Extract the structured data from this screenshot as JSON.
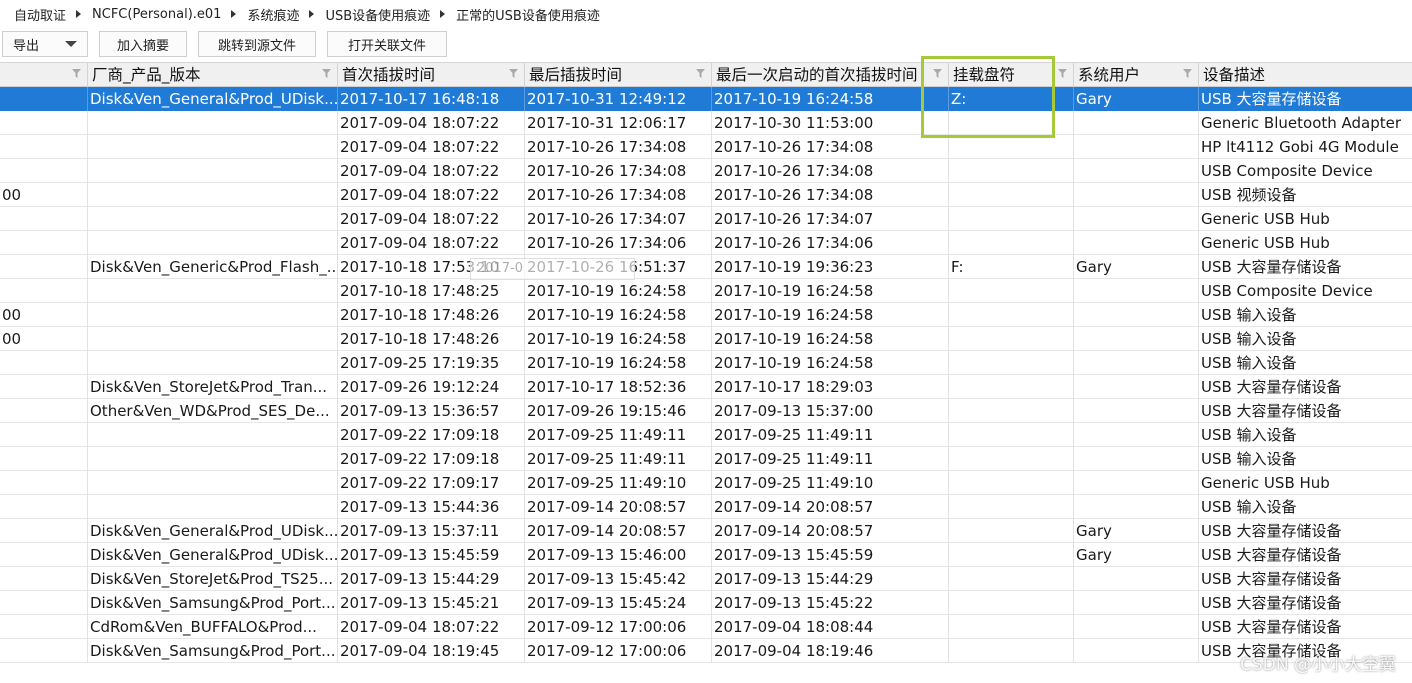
{
  "breadcrumb": [
    "自动取证",
    "NCFC(Personal).e01",
    "系统痕迹",
    "USB设备使用痕迹",
    "正常的USB设备使用痕迹"
  ],
  "toolbar": {
    "export_label": "导出",
    "add_summary_label": "加入摘要",
    "goto_source_label": "跳转到源文件",
    "open_related_label": "打开关联文件"
  },
  "columns": [
    "",
    "厂商_产品_版本",
    "首次插拔时间",
    "最后插拔时间",
    "最后一次启动的首次插拔时间",
    "挂载盘符",
    "系统用户",
    "设备描述"
  ],
  "rows": [
    [
      "",
      "Disk&Ven_General&Prod_UDisk...",
      "2017-10-17 16:48:18",
      "2017-10-31 12:49:12",
      "2017-10-19 16:24:58",
      "Z:",
      "Gary",
      "USB 大容量存储设备"
    ],
    [
      "",
      "",
      "2017-09-04 18:07:22",
      "2017-10-31 12:06:17",
      "2017-10-30 11:53:00",
      "",
      "",
      "Generic Bluetooth Adapter"
    ],
    [
      "",
      "",
      "2017-09-04 18:07:22",
      "2017-10-26 17:34:08",
      "2017-10-26 17:34:08",
      "",
      "",
      "HP lt4112 Gobi 4G Module"
    ],
    [
      "",
      "",
      "2017-09-04 18:07:22",
      "2017-10-26 17:34:08",
      "2017-10-26 17:34:08",
      "",
      "",
      "USB Composite Device"
    ],
    [
      "00",
      "",
      "2017-09-04 18:07:22",
      "2017-10-26 17:34:08",
      "2017-10-26 17:34:08",
      "",
      "",
      "USB 视频设备"
    ],
    [
      "",
      "",
      "2017-09-04 18:07:22",
      "2017-10-26 17:34:07",
      "2017-10-26 17:34:07",
      "",
      "",
      "Generic USB Hub"
    ],
    [
      "",
      "",
      "2017-09-04 18:07:22",
      "2017-10-26 17:34:06",
      "2017-10-26 17:34:06",
      "",
      "",
      "Generic USB Hub"
    ],
    [
      "",
      "Disk&Ven_Generic&Prod_Flash_...",
      "2017-10-18 17:53:10",
      "2017-10-26 16:51:37",
      "2017-10-19 19:36:23",
      "F:",
      "Gary",
      "USB 大容量存储设备"
    ],
    [
      "",
      "",
      "2017-10-18 17:48:25",
      "2017-10-19 16:24:58",
      "2017-10-19 16:24:58",
      "",
      "",
      "USB Composite Device"
    ],
    [
      "00",
      "",
      "2017-10-18 17:48:26",
      "2017-10-19 16:24:58",
      "2017-10-19 16:24:58",
      "",
      "",
      "USB 输入设备"
    ],
    [
      "00",
      "",
      "2017-10-18 17:48:26",
      "2017-10-19 16:24:58",
      "2017-10-19 16:24:58",
      "",
      "",
      "USB 输入设备"
    ],
    [
      "",
      "",
      "2017-09-25 17:19:35",
      "2017-10-19 16:24:58",
      "2017-10-19 16:24:58",
      "",
      "",
      "USB 输入设备"
    ],
    [
      "",
      "Disk&Ven_StoreJet&Prod_Tran...",
      "2017-09-26 19:12:24",
      "2017-10-17 18:52:36",
      "2017-10-17 18:29:03",
      "",
      "",
      "USB 大容量存储设备"
    ],
    [
      "",
      "Other&Ven_WD&Prod_SES_De...",
      "2017-09-13 15:36:57",
      "2017-09-26 19:15:46",
      "2017-09-13 15:37:00",
      "",
      "",
      "USB 大容量存储设备"
    ],
    [
      "",
      "",
      "2017-09-22 17:09:18",
      "2017-09-25 11:49:11",
      "2017-09-25 11:49:11",
      "",
      "",
      "USB 输入设备"
    ],
    [
      "",
      "",
      "2017-09-22 17:09:18",
      "2017-09-25 11:49:11",
      "2017-09-25 11:49:11",
      "",
      "",
      "USB 输入设备"
    ],
    [
      "",
      "",
      "2017-09-22 17:09:17",
      "2017-09-25 11:49:10",
      "2017-09-25 11:49:10",
      "",
      "",
      "Generic USB Hub"
    ],
    [
      "",
      "",
      "2017-09-13 15:44:36",
      "2017-09-14 20:08:57",
      "2017-09-14 20:08:57",
      "",
      "",
      "USB 输入设备"
    ],
    [
      "",
      "Disk&Ven_General&Prod_UDisk...",
      "2017-09-13 15:37:11",
      "2017-09-14 20:08:57",
      "2017-09-14 20:08:57",
      "",
      "Gary",
      "USB 大容量存储设备"
    ],
    [
      "",
      "Disk&Ven_General&Prod_UDisk...",
      "2017-09-13 15:45:59",
      "2017-09-13 15:46:00",
      "2017-09-13 15:45:59",
      "",
      "Gary",
      "USB 大容量存储设备"
    ],
    [
      "",
      "Disk&Ven_StoreJet&Prod_TS25...",
      "2017-09-13 15:44:29",
      "2017-09-13 15:45:42",
      "2017-09-13 15:44:29",
      "",
      "",
      "USB 大容量存储设备"
    ],
    [
      "",
      "Disk&Ven_Samsung&Prod_Port...",
      "2017-09-13 15:45:21",
      "2017-09-13 15:45:24",
      "2017-09-13 15:45:22",
      "",
      "",
      "USB 大容量存储设备"
    ],
    [
      "",
      "CdRom&Ven_BUFFALO&Prod...",
      "2017-09-04 18:07:22",
      "2017-09-12 17:00:06",
      "2017-09-04 18:08:44",
      "",
      "",
      "USB 大容量存储设备"
    ],
    [
      "",
      "Disk&Ven_Samsung&Prod_Port...",
      "2017-09-04 18:19:45",
      "2017-09-12 17:00:06",
      "2017-09-04 18:19:46",
      "",
      "",
      "USB 大容量存储设备"
    ]
  ],
  "selected_row": 0,
  "ghost_text": "2017-0",
  "watermark": "CSDN @小小大空翼",
  "colors": {
    "selection": "#1f7bd6",
    "highlight_box": "#a6c93a",
    "header_bg": "#f0f0f0"
  }
}
